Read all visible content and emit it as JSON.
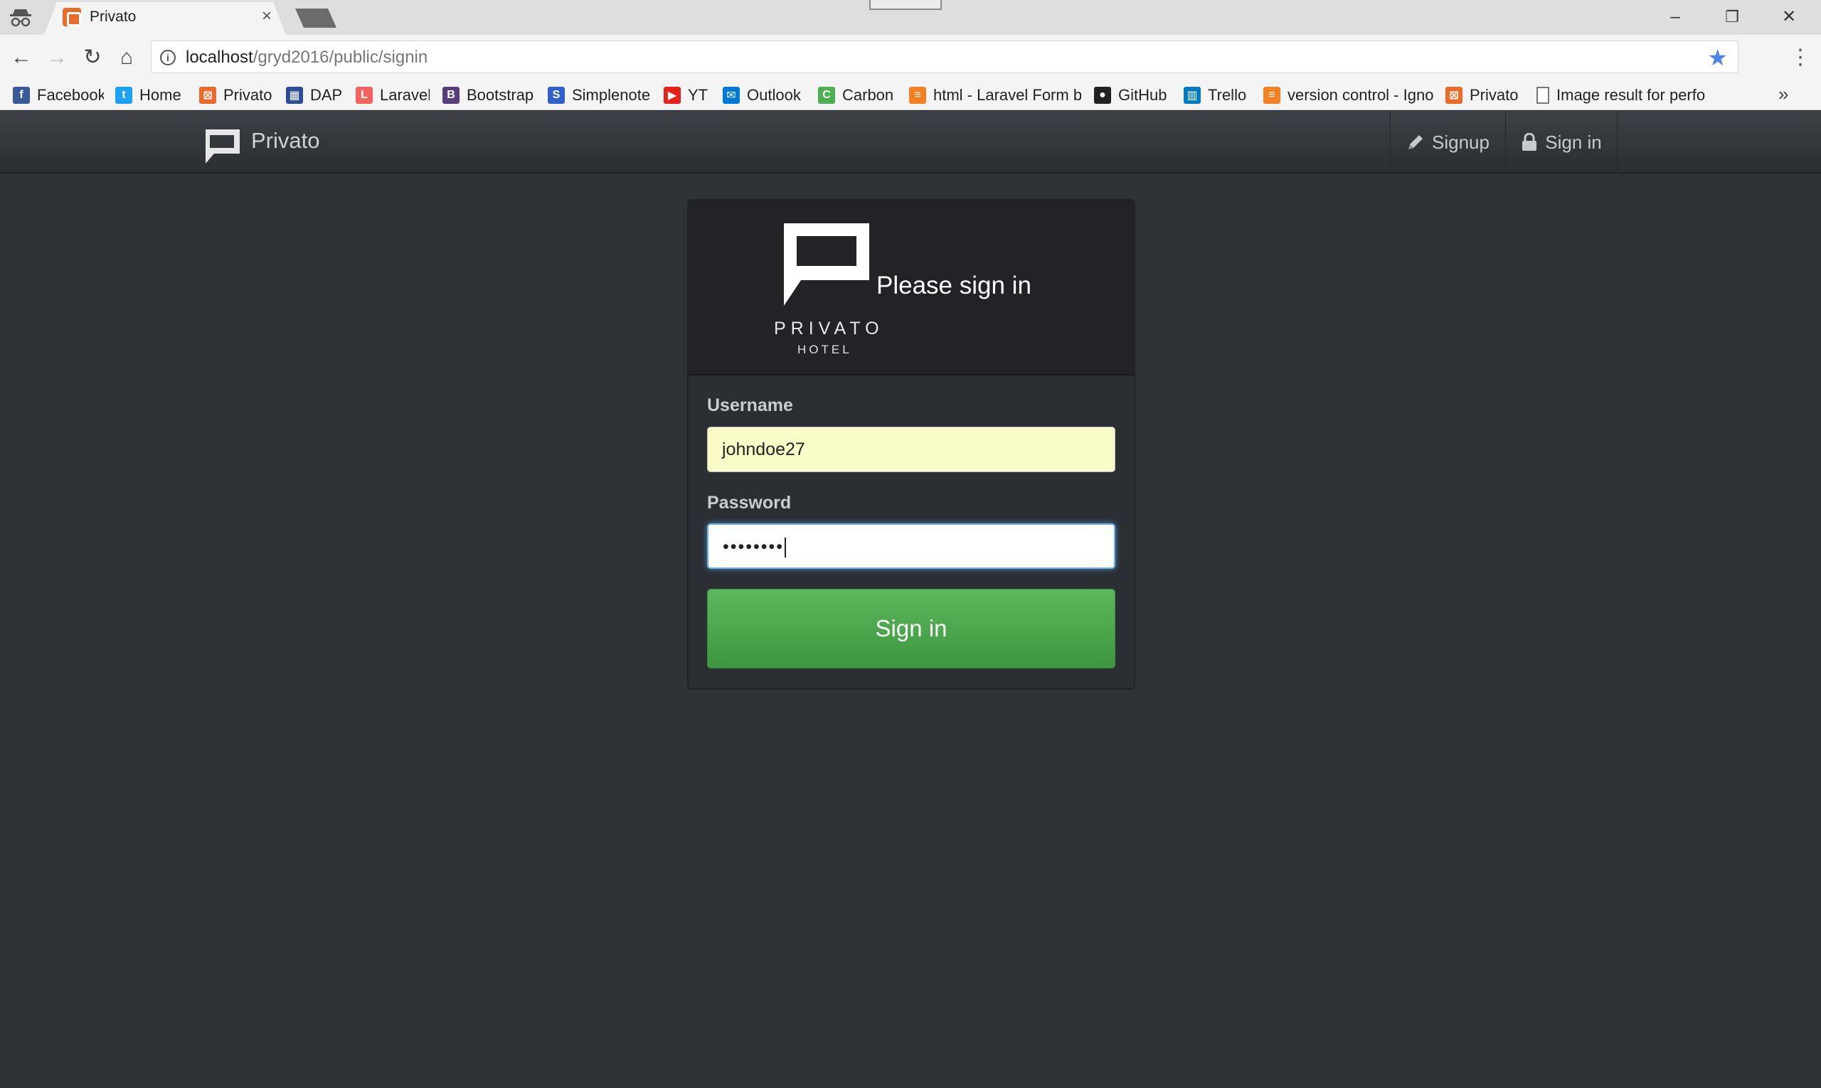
{
  "browser": {
    "tab_title": "Privato",
    "tab_close": "×",
    "window_controls": {
      "minimize": "–",
      "restore": "❐",
      "close": "✕"
    },
    "url_host": "localhost",
    "url_path": "/gryd2016/public/signin",
    "info_icon": "i",
    "back": "←",
    "forward": "→",
    "reload": "↻",
    "home": "⌂",
    "bookmark_star": "★",
    "menu": "⋮",
    "more_bookmarks": "»"
  },
  "bookmarks": [
    {
      "label": "Facebook",
      "icon": "facebook-icon",
      "color": "#3b5998",
      "glyph": "f"
    },
    {
      "label": "Home",
      "icon": "twitter-icon",
      "color": "#1da1f2",
      "glyph": "t"
    },
    {
      "label": "Privato",
      "icon": "xampp-icon",
      "color": "#e96b2c",
      "glyph": "⊠"
    },
    {
      "label": "DAP",
      "icon": "dap-icon",
      "color": "#2b4c9b",
      "glyph": "▦"
    },
    {
      "label": "Laravel",
      "icon": "laravel-icon",
      "color": "#f4645f",
      "glyph": "L"
    },
    {
      "label": "Bootstrap",
      "icon": "bootstrap-icon",
      "color": "#563d7c",
      "glyph": "B"
    },
    {
      "label": "Simplenote",
      "icon": "simplenote-icon",
      "color": "#3361cc",
      "glyph": "S"
    },
    {
      "label": "YT",
      "icon": "youtube-icon",
      "color": "#e62117",
      "glyph": "▶"
    },
    {
      "label": "Outlook",
      "icon": "outlook-icon",
      "color": "#0078d7",
      "glyph": "✉"
    },
    {
      "label": "Carbon",
      "icon": "carbon-icon",
      "color": "#4caf50",
      "glyph": "C"
    },
    {
      "label": "html - Laravel Form b",
      "icon": "stackoverflow-icon",
      "color": "#f48024",
      "glyph": "≡"
    },
    {
      "label": "GitHub",
      "icon": "github-icon",
      "color": "#222222",
      "glyph": "●"
    },
    {
      "label": "Trello",
      "icon": "trello-icon",
      "color": "#0079bf",
      "glyph": "▥"
    },
    {
      "label": "version control - Igno",
      "icon": "stackoverflow-icon",
      "color": "#f48024",
      "glyph": "≡"
    },
    {
      "label": "Privato",
      "icon": "xampp-icon",
      "color": "#e96b2c",
      "glyph": "⊠"
    },
    {
      "label": "Image result for perfo",
      "icon": "page-icon",
      "color": "#ffffff",
      "glyph": ""
    }
  ],
  "navbar": {
    "brand": "Privato",
    "signup_label": "Signup",
    "signin_label": "Sign in"
  },
  "signin": {
    "title": "Please sign in",
    "logo_word": "PRIVATO",
    "logo_sub": "HOTEL",
    "username_label": "Username",
    "username_value": "johndoe27",
    "password_label": "Password",
    "password_masked": "••••••••",
    "button_label": "Sign in"
  },
  "colors": {
    "page_bg": "#2e3338",
    "success": "#5cb85c",
    "focus": "#66afe9",
    "autofill": "#fafcc8"
  }
}
